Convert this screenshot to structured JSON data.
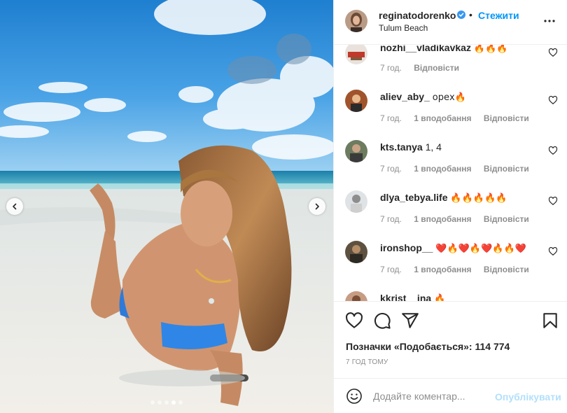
{
  "post": {
    "username": "reginatodorenko",
    "separator": "•",
    "follow_label": "Стежити",
    "location": "Tulum Beach"
  },
  "carousel": {
    "slide_count": 5,
    "active_index": 3
  },
  "comments": [
    {
      "user": "nozhi__vladikavkaz",
      "text": "🔥🔥🔥",
      "time": "7 год.",
      "likes": "",
      "reply": "Відповісти"
    },
    {
      "user": "aliev_aby_",
      "text": "орех🔥",
      "time": "7 год.",
      "likes": "1 вподобання",
      "reply": "Відповісти"
    },
    {
      "user": "kts.tanya",
      "text": "1, 4",
      "time": "7 год.",
      "likes": "1 вподобання",
      "reply": "Відповісти"
    },
    {
      "user": "dlya_tebya.life",
      "text": "🔥🔥🔥🔥🔥",
      "time": "7 год.",
      "likes": "1 вподобання",
      "reply": "Відповісти"
    },
    {
      "user": "ironshop__",
      "text": "❤️🔥❤️🔥❤️🔥🔥❤️",
      "time": "7 год.",
      "likes": "1 вподобання",
      "reply": "Відповісти"
    },
    {
      "user": "kkrist__ina",
      "text": "🔥",
      "time": "",
      "likes": "",
      "reply": ""
    }
  ],
  "actions": {
    "likes_text": "Позначки «Подобається»: 114 774",
    "time_ago": "7 ГОД ТОМУ"
  },
  "add_comment": {
    "placeholder": "Додайте коментар...",
    "publish_label": "Опублікувати"
  },
  "icons": {
    "verified": "verified-badge-icon",
    "more": "more-options-icon",
    "like": "heart-icon",
    "comment": "comment-icon",
    "share": "share-icon",
    "save": "bookmark-icon",
    "emoji": "emoji-icon",
    "prev": "chevron-left-icon",
    "next": "chevron-right-icon"
  },
  "colors": {
    "accent": "#0095f6",
    "publish_disabled": "#b2dffc",
    "verified": "#3897f0"
  }
}
